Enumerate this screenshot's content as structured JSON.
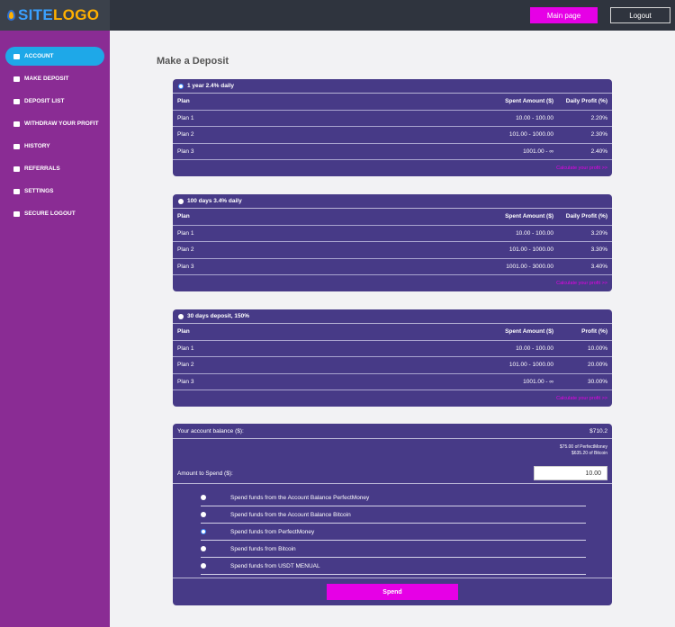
{
  "header": {
    "logo_site": "SITE",
    "logo_logo": "LOGO",
    "main_page": "Main page",
    "logout": "Logout"
  },
  "sidebar": {
    "items": [
      {
        "label": "Account",
        "icon": "dashboard-icon"
      },
      {
        "label": "Make Deposit",
        "icon": "gear-icon"
      },
      {
        "label": "Deposit List",
        "icon": "search-icon"
      },
      {
        "label": "Withdraw Your Profit",
        "icon": "wallet-icon"
      },
      {
        "label": "History",
        "icon": "history-icon"
      },
      {
        "label": "Referrals",
        "icon": "handshake-icon"
      },
      {
        "label": "Settings",
        "icon": "settings-icon"
      },
      {
        "label": "Secure Logout",
        "icon": "logout-icon"
      }
    ]
  },
  "main": {
    "title": "Make a Deposit",
    "plans": [
      {
        "name": "1 year 2.4% daily",
        "headers": [
          "Plan",
          "Spent Amount ($)",
          "Daily Profit (%)"
        ],
        "rows": [
          [
            "Plan 1",
            "10.00 - 100.00",
            "2.20%"
          ],
          [
            "Plan 2",
            "101.00 - 1000.00",
            "2.30%"
          ],
          [
            "Plan 3",
            "1001.00 - ∞",
            "2.40%"
          ]
        ],
        "calc_link": "Calculate your profit >>"
      },
      {
        "name": "100 days 3.4% daily",
        "headers": [
          "Plan",
          "Spent Amount ($)",
          "Daily Profit (%)"
        ],
        "rows": [
          [
            "Plan 1",
            "10.00 - 100.00",
            "3.20%"
          ],
          [
            "Plan 2",
            "101.00 - 1000.00",
            "3.30%"
          ],
          [
            "Plan 3",
            "1001.00 - 3000.00",
            "3.40%"
          ]
        ],
        "calc_link": "Calculate your profit >>"
      },
      {
        "name": "30 days deposit, 150%",
        "headers": [
          "Plan",
          "Spent Amount ($)",
          "Profit (%)"
        ],
        "rows": [
          [
            "Plan 1",
            "10.00 - 100.00",
            "10.00%"
          ],
          [
            "Plan 2",
            "101.00 - 1000.00",
            "20.00%"
          ],
          [
            "Plan 3",
            "1001.00 - ∞",
            "30.00%"
          ]
        ],
        "calc_link": "Calculate your profit >>"
      }
    ],
    "form": {
      "balance_label": "Your account balance ($):",
      "balance_value": "$710.2",
      "balance_detail_1": "$75.00 of PerfectMoney",
      "balance_detail_2": "$635.20 of Bitcoin",
      "amount_label": "Amount to Spend ($):",
      "amount_value": "10.00",
      "options": [
        "Spend funds from the Account Balance PerfectMoney",
        "Spend funds from the Account Balance Bitcoin",
        "Spend funds from PerfectMoney",
        "Spend funds from Bitcoin",
        "Spend funds from USDT MENUAL"
      ],
      "selected_option": 2,
      "spend_button": "Spend"
    }
  },
  "colors": {
    "sidebar": "#8a2c94",
    "active_nav": "#1ea8e8",
    "panel": "#473a87",
    "accent": "#e600e6",
    "header": "#2f343e"
  }
}
